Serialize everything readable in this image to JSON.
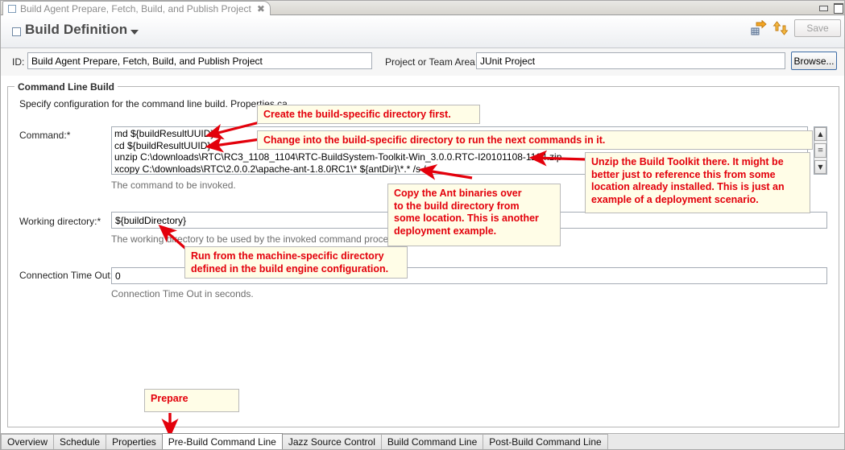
{
  "window": {
    "editor_tab_label": "Build Agent Prepare, Fetch, Build, and Publish Project",
    "close_glyph": "✖",
    "minimize_tooltip": "Minimize",
    "maximize_tooltip": "Maximize"
  },
  "header": {
    "title": "Build Definition",
    "save_label": "Save",
    "request_build_icon": "request-build-icon",
    "refresh_icon": "refresh-icon"
  },
  "id_row": {
    "id_label": "ID:",
    "id_value": "Build Agent Prepare, Fetch, Build, and Publish Project",
    "area_label": "Project or Team Area:",
    "area_value": "JUnit Project",
    "browse_label": "Browse..."
  },
  "section": {
    "title": "Command Line Build",
    "description": "Specify configuration for the command line build. Properties ca"
  },
  "fields": {
    "command": {
      "label": "Command:*",
      "hint": "The command to be invoked.",
      "lines": [
        "md ${buildResultUUID}",
        "cd ${buildResultUUID}",
        "unzip C:\\downloads\\RTC\\RC3_1108_1104\\RTC-BuildSystem-Toolkit-Win_3.0.0.RTC-I20101108-1104.zip",
        "xcopy C:\\downloads\\RTC\\2.0.0.2\\apache-ant-1.8.0RC1\\* ${antDir}\\*.* /s /e"
      ]
    },
    "working_directory": {
      "label": "Working directory:*",
      "hint": "The working directory to be used by the invoked command process.",
      "value": "${buildDirectory}"
    },
    "connection_timeout": {
      "label": "Connection Time Out:",
      "hint": "Connection Time Out in seconds.",
      "value": "0"
    }
  },
  "annotations": [
    {
      "name": "callout-create-directory",
      "text": "Create the build-specific directory first."
    },
    {
      "name": "callout-change-directory",
      "text": "Change into the build-specific directory to run the next commands in it."
    },
    {
      "name": "callout-unzip-toolkit",
      "text": "Unzip the Build Toolkit there.  It might be\nbetter just to reference this from some\nlocation already installed.  This is just an\nexample of a deployment scenario."
    },
    {
      "name": "callout-copy-ant",
      "text": "Copy the Ant binaries over\nto the build directory from\nsome location.   This is another\ndeployment example."
    },
    {
      "name": "callout-machine-directory",
      "text": "Run from the machine-specific directory\ndefined in the build engine configuration."
    },
    {
      "name": "callout-prepare",
      "text": "Prepare"
    }
  ],
  "bottom_tabs": [
    {
      "label": "Overview",
      "active": false
    },
    {
      "label": "Schedule",
      "active": false
    },
    {
      "label": "Properties",
      "active": false
    },
    {
      "label": "Pre-Build Command Line",
      "active": true
    },
    {
      "label": "Jazz Source Control",
      "active": false
    },
    {
      "label": "Build Command Line",
      "active": false
    },
    {
      "label": "Post-Build Command Line",
      "active": false
    }
  ],
  "colors": {
    "annotation_text": "#e3000b",
    "annotation_bg": "#fffde7",
    "arrow": "#e3000b"
  }
}
